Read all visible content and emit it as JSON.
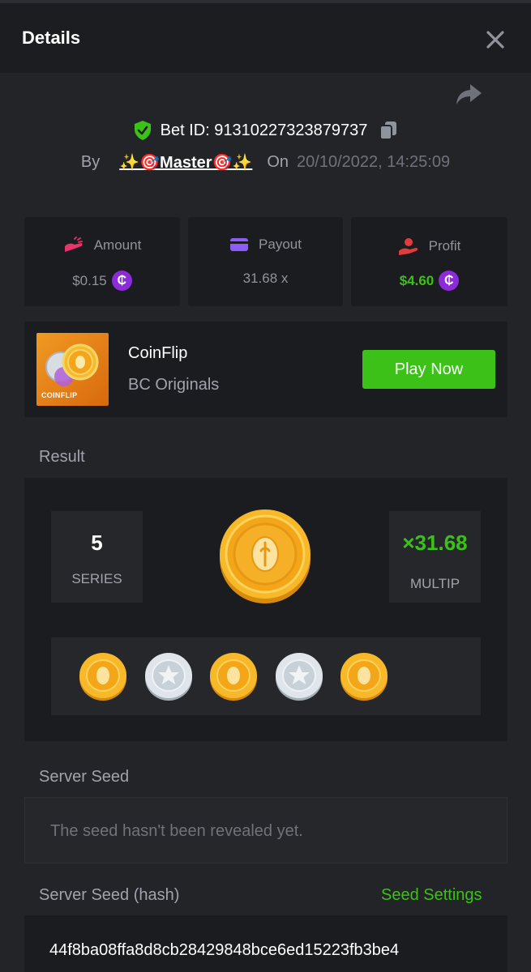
{
  "header": {
    "title": "Details"
  },
  "bet": {
    "id_text": "Bet ID: 91310227323879737",
    "by_label": "By",
    "username": "✨🎯Master🎯✨",
    "on_label": "On",
    "datetime": "20/10/2022, 14:25:09"
  },
  "stats": {
    "amount": {
      "label": "Amount",
      "value": "$0.15"
    },
    "payout": {
      "label": "Payout",
      "value": "31.68 x"
    },
    "profit": {
      "label": "Profit",
      "value": "$4.60"
    }
  },
  "currency_symbol": "₵",
  "game": {
    "name": "CoinFlip",
    "provider": "BC Originals",
    "thumb_label": "COINFLIP",
    "play_label": "Play Now"
  },
  "result": {
    "label": "Result",
    "series_value": "5",
    "series_label": "SERIES",
    "multiplier_value": "×31.68",
    "multiplier_label": "MULTIP",
    "main_coin": "gold",
    "coins": [
      "gold",
      "silver",
      "gold",
      "silver",
      "gold"
    ]
  },
  "server_seed": {
    "label": "Server Seed",
    "value": "The seed hasn't been revealed yet."
  },
  "server_seed_hash": {
    "label": "Server Seed (hash)",
    "settings_label": "Seed Settings",
    "value": "44f8ba08ffa8d8cb28429848bce6ed15223fb3be4"
  },
  "colors": {
    "accent_green": "#3bc117",
    "currency_purple": "#8c2bd9",
    "background": "#232428",
    "card": "#1b1c1f"
  },
  "icons": {
    "close": "close-icon",
    "share": "share-icon",
    "shield": "shield-check-icon",
    "copy": "copy-icon",
    "amount": "amount-icon",
    "payout": "payout-card-icon",
    "profit": "profit-hand-icon"
  }
}
